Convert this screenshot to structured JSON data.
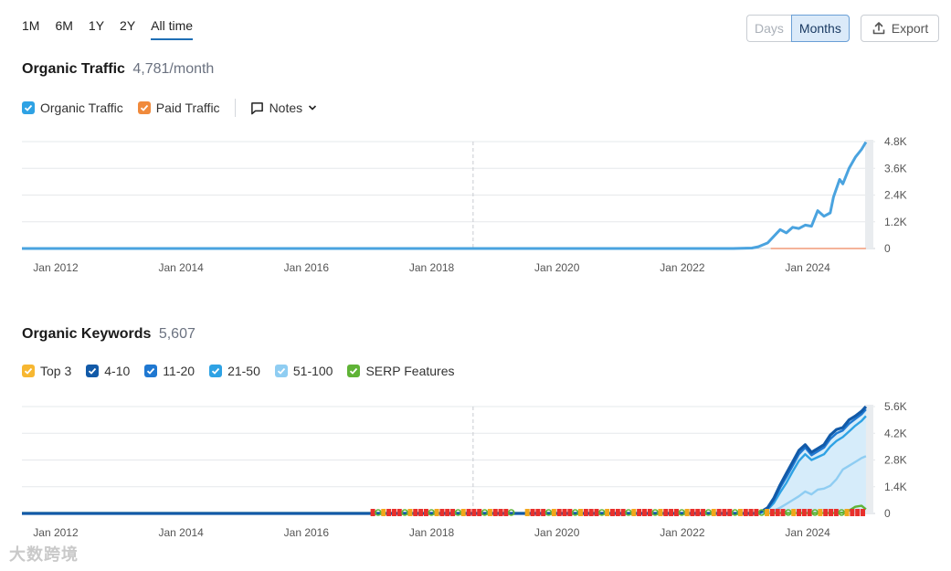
{
  "range_tabs": [
    "1M",
    "6M",
    "1Y",
    "2Y",
    "All time"
  ],
  "active_range": "All time",
  "granularity": {
    "days": "Days",
    "months": "Months",
    "active": "Months"
  },
  "export_label": "Export",
  "traffic": {
    "title": "Organic Traffic",
    "subtitle": "4,781/month",
    "legend": [
      {
        "label": "Organic Traffic",
        "color": "#2ea2e4"
      },
      {
        "label": "Paid Traffic",
        "color": "#f08a3c"
      }
    ],
    "notes_label": "Notes"
  },
  "keywords": {
    "title": "Organic Keywords",
    "subtitle": "5,607",
    "legend": [
      {
        "label": "Top 3",
        "color": "#f7b731"
      },
      {
        "label": "4-10",
        "color": "#125aa8"
      },
      {
        "label": "11-20",
        "color": "#1f78d1"
      },
      {
        "label": "21-50",
        "color": "#2ea2e4"
      },
      {
        "label": "51-100",
        "color": "#8fcdf2"
      },
      {
        "label": "SERP Features",
        "color": "#5fb336"
      }
    ]
  },
  "x_axis_labels": [
    "Jan 2012",
    "Jan 2014",
    "Jan 2016",
    "Jan 2018",
    "Jan 2020",
    "Jan 2022",
    "Jan 2024"
  ],
  "watermark": "大数跨境",
  "chart_data": [
    {
      "type": "line",
      "xlim": [
        2011.85,
        2025.35
      ],
      "ylim": [
        0,
        4800
      ],
      "yticks": [
        "4.8K",
        "3.6K",
        "2.4K",
        "1.2K",
        "0"
      ],
      "ytick_values": [
        4800,
        3600,
        2400,
        1200,
        0
      ],
      "grid": true,
      "series": [
        {
          "name": "Organic Traffic",
          "color": "#4aa3df",
          "x": [
            2011.85,
            2023.2,
            2023.5,
            2023.6,
            2023.75,
            2023.85,
            2023.95,
            2024.05,
            2024.15,
            2024.25,
            2024.35,
            2024.45,
            2024.55,
            2024.65,
            2024.75,
            2024.8,
            2024.9,
            2024.95,
            2025.0,
            2025.05,
            2025.15,
            2025.25,
            2025.32
          ],
          "y": [
            0,
            0,
            20,
            80,
            250,
            550,
            850,
            700,
            950,
            900,
            1050,
            1000,
            1700,
            1450,
            1600,
            2300,
            3100,
            2900,
            3250,
            3600,
            4100,
            4450,
            4780
          ]
        },
        {
          "name": "Paid Traffic",
          "color": "#f4b39a",
          "x": [
            2023.8,
            2025.32
          ],
          "y": [
            0,
            0
          ]
        }
      ]
    },
    {
      "type": "area",
      "xlim": [
        2011.85,
        2025.35
      ],
      "ylim": [
        0,
        5600
      ],
      "yticks": [
        "5.6K",
        "4.2K",
        "2.8K",
        "1.4K",
        "0"
      ],
      "ytick_values": [
        5600,
        4200,
        2800,
        1400,
        0
      ],
      "grid": true,
      "x": [
        2011.85,
        2023.6,
        2023.75,
        2023.85,
        2023.95,
        2024.05,
        2024.15,
        2024.25,
        2024.35,
        2024.45,
        2024.55,
        2024.65,
        2024.75,
        2024.85,
        2024.95,
        2025.05,
        2025.15,
        2025.25,
        2025.32
      ],
      "series": [
        {
          "name": "4-10",
          "color": "#125aa8",
          "values": [
            0,
            0,
            300,
            800,
            1500,
            2100,
            2700,
            3300,
            3600,
            3200,
            3400,
            3600,
            4100,
            4400,
            4500,
            4900,
            5100,
            5350,
            5600
          ]
        },
        {
          "name": "11-20",
          "color": "#1f78d1",
          "values": [
            0,
            0,
            250,
            700,
            1350,
            1900,
            2500,
            3100,
            3450,
            3050,
            3250,
            3450,
            3900,
            4200,
            4350,
            4700,
            4950,
            5200,
            5450
          ]
        },
        {
          "name": "21-50",
          "color": "#2ea2e4",
          "values": [
            0,
            0,
            200,
            550,
            1100,
            1600,
            2200,
            2750,
            3100,
            2800,
            2950,
            3100,
            3500,
            3800,
            4000,
            4300,
            4600,
            4850,
            5100
          ]
        },
        {
          "name": "51-100",
          "color": "#8fcdf2",
          "values": [
            0,
            0,
            50,
            150,
            300,
            500,
            700,
            900,
            1150,
            1000,
            1250,
            1300,
            1450,
            1800,
            2300,
            2500,
            2700,
            2900,
            3000
          ]
        },
        {
          "name": "SERP Features",
          "color": "#5fb336",
          "values": [
            20,
            20,
            20,
            20,
            20,
            20,
            20,
            20,
            20,
            20,
            20,
            20,
            20,
            20,
            40,
            150,
            350,
            400,
            220
          ]
        }
      ]
    }
  ]
}
